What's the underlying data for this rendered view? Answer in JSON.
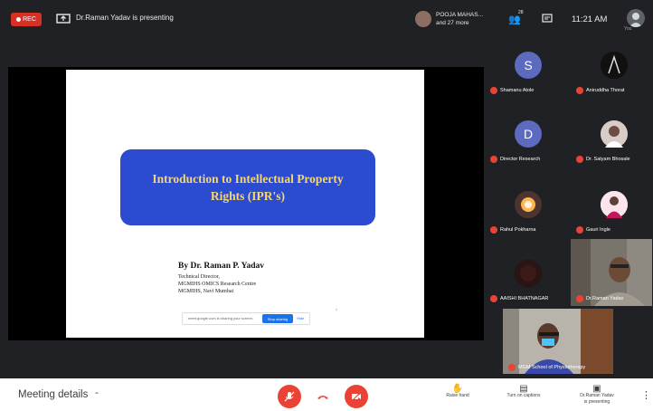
{
  "topbar": {
    "rec_label": "REC",
    "presenting_text": "Dr.Raman Yadav is presenting",
    "participants_name": "POOJA MAHAS...",
    "participants_more": "and 27 more",
    "participants_count": "28",
    "time": "11:21 AM",
    "you_label": "You"
  },
  "slide": {
    "title": "Introduction to Intellectual Property Rights (IPR's)",
    "author": "By  Dr. Raman P. Yadav",
    "affiliation_line1": "Technical Director,",
    "affiliation_line2": "MGMIHS OMICS Research Centre",
    "affiliation_line3": "MGMIHS, Navi Mumbai",
    "share_text": "meet.google.com is sharing your screen.",
    "stop_sharing": "Stop sharing",
    "hide": "Hide"
  },
  "participants": [
    {
      "name": "Shamanu Atole",
      "initial": "S",
      "color": "#5c6bc0"
    },
    {
      "name": "Aniruddha Thorat",
      "initial": "",
      "color": "#111111"
    },
    {
      "name": "Director Research",
      "initial": "D",
      "color": "#5c6bc0"
    },
    {
      "name": "Dr. Satyam Bhosale",
      "initial": "",
      "color": "#a1887f"
    },
    {
      "name": "Rahul Pokharna",
      "initial": "",
      "color": "#ff9800"
    },
    {
      "name": "Gauri Ingle",
      "initial": "",
      "color": "#ad1457"
    },
    {
      "name": "AAISHI BHATNAGAR",
      "initial": "",
      "color": "#3e2723"
    },
    {
      "name": "Dr.Raman Yadav",
      "initial": "",
      "color": "#8d6e63"
    },
    {
      "name": "MGM School of Physiotherapy",
      "initial": "",
      "color": "#8d6e63"
    }
  ],
  "bottombar": {
    "meeting_details": "Meeting details",
    "raise_hand": "Raise hand",
    "captions": "Turn on captions",
    "presenting_line1": "Dr.Raman Yadav",
    "presenting_line2": "is presenting"
  },
  "colors": {
    "rec": "#d93025",
    "slide_title_bg": "#2b4bd0",
    "slide_title_text": "#f5d76e",
    "mic_off": "#ea4335",
    "end_call": "#ea4335",
    "accent_blue": "#1a73e8"
  }
}
